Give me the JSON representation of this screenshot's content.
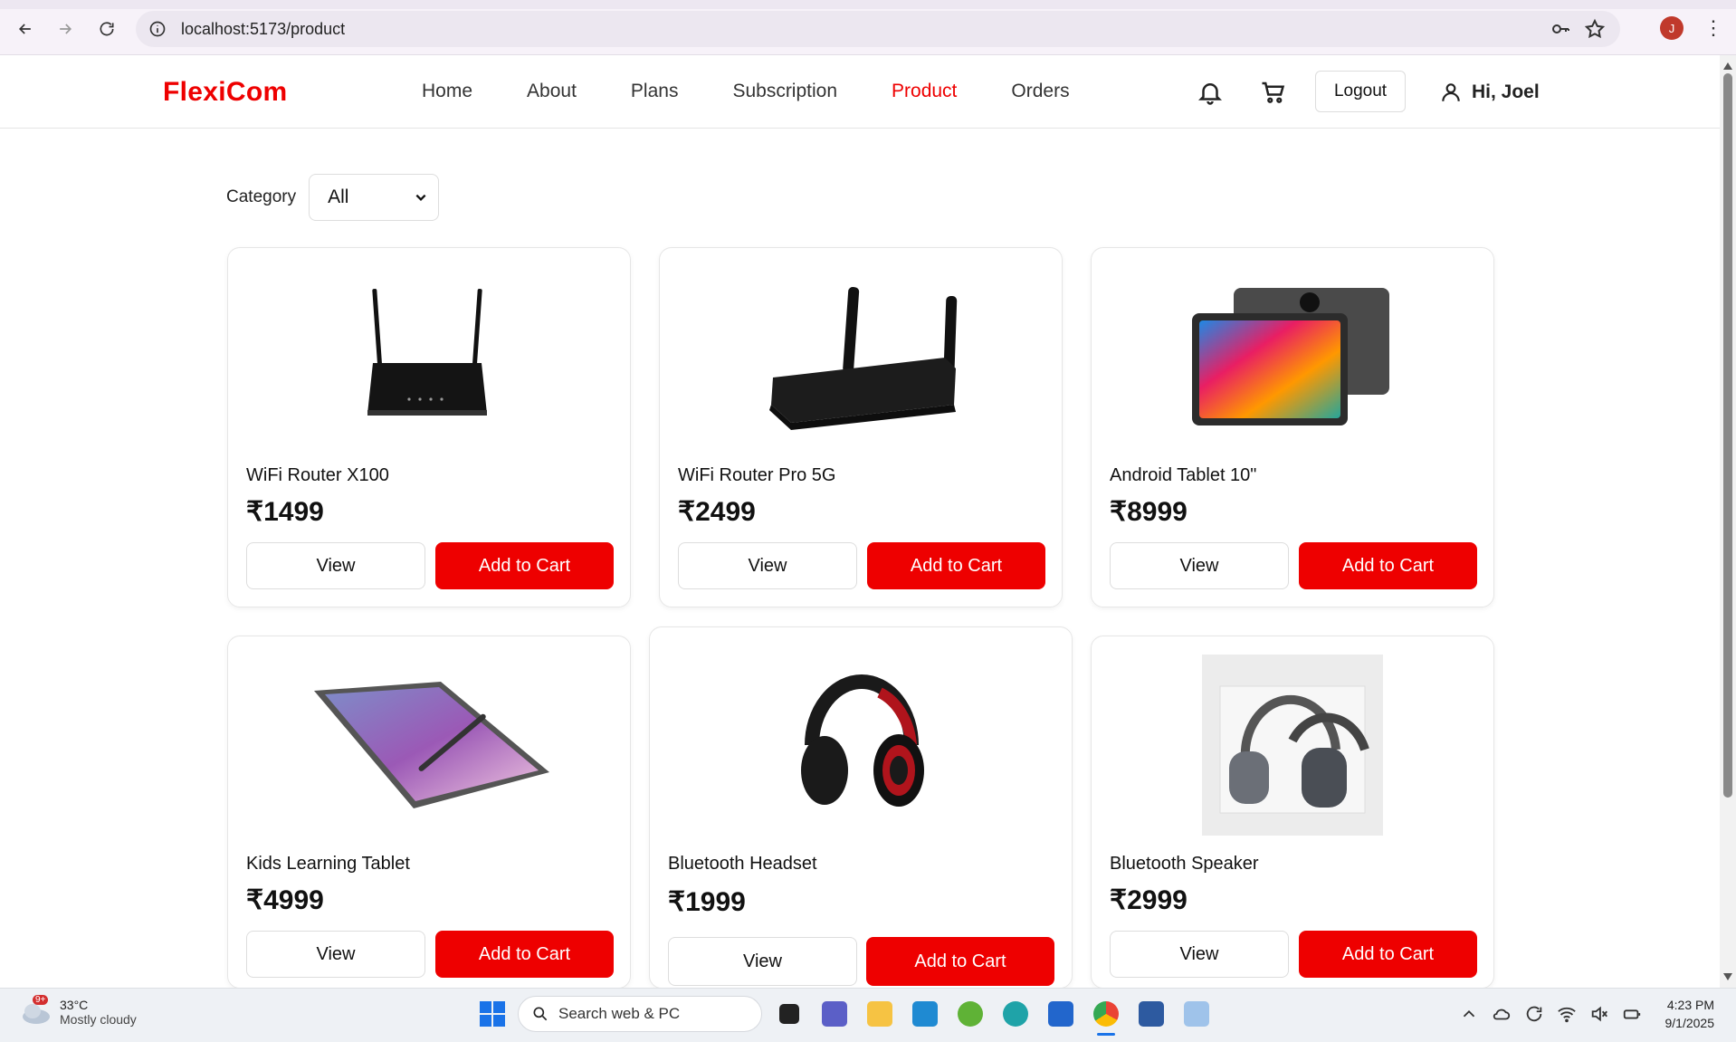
{
  "browser": {
    "url": "localhost:5173/product",
    "profile_initial": "J"
  },
  "header": {
    "logo": "FlexiCom",
    "nav": [
      {
        "label": "Home",
        "active": false
      },
      {
        "label": "About",
        "active": false
      },
      {
        "label": "Plans",
        "active": false
      },
      {
        "label": "Subscription",
        "active": false
      },
      {
        "label": "Product",
        "active": true
      },
      {
        "label": "Orders",
        "active": false
      }
    ],
    "logout_label": "Logout",
    "greeting": "Hi, Joel"
  },
  "filter": {
    "label": "Category",
    "selected": "All"
  },
  "products": [
    {
      "name": "WiFi Router X100",
      "price": "₹1499",
      "view_label": "View",
      "add_label": "Add to Cart",
      "image": "router-black-icon"
    },
    {
      "name": "WiFi Router Pro 5G",
      "price": "₹2499",
      "view_label": "View",
      "add_label": "Add to Cart",
      "image": "router-pro-icon"
    },
    {
      "name": "Android Tablet 10\"",
      "price": "₹8999",
      "view_label": "View",
      "add_label": "Add to Cart",
      "image": "tablet-icon"
    },
    {
      "name": "Kids Learning Tablet",
      "price": "₹4999",
      "view_label": "View",
      "add_label": "Add to Cart",
      "image": "tablet-pen-icon"
    },
    {
      "name": "Bluetooth Headset",
      "price": "₹1999",
      "view_label": "View",
      "add_label": "Add to Cart",
      "image": "headphones-red-icon"
    },
    {
      "name": "Bluetooth Speaker",
      "price": "₹2999",
      "view_label": "View",
      "add_label": "Add to Cart",
      "image": "headphones-box-icon"
    }
  ],
  "taskbar": {
    "weather_badge": "9+",
    "temperature": "33°C",
    "condition": "Mostly cloudy",
    "search_placeholder": "Search web & PC",
    "time": "4:23 PM",
    "date": "9/1/2025"
  },
  "colors": {
    "accent": "#ee0000",
    "text": "#111111"
  }
}
